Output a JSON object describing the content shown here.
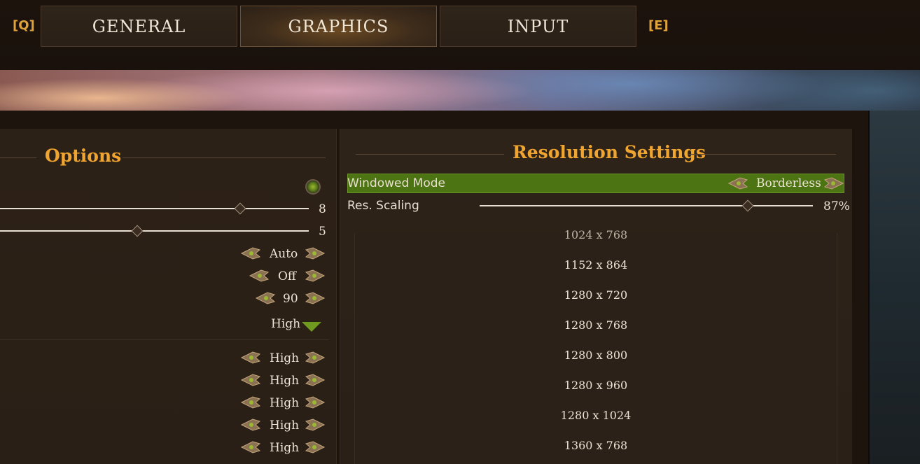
{
  "tabs": {
    "prev_key": "[Q]",
    "next_key": "[E]",
    "general": "GENERAL",
    "graphics": "GRAPHICS",
    "input": "INPUT"
  },
  "left_panel": {
    "title": "Options",
    "slider1_value": "8",
    "slider2_value": "5",
    "opt1": "Auto",
    "opt2": "Off",
    "opt3": "90",
    "dropdown_value": "High",
    "quality_rows": [
      "High",
      "High",
      "High",
      "High",
      "High"
    ]
  },
  "right_panel": {
    "title": "Resolution Settings",
    "windowed_mode_label": "Windowed Mode",
    "windowed_mode_value": "Borderless",
    "res_scaling_label": "Res. Scaling",
    "res_scaling_value": "87%",
    "resolutions": [
      "1024 x 768",
      "1152 x 864",
      "1280 x 720",
      "1280 x 768",
      "1280 x 800",
      "1280 x 960",
      "1280 x 1024",
      "1360 x 768"
    ]
  },
  "colors": {
    "accent_gold": "#f0a530",
    "highlight_green": "#4d7412"
  }
}
